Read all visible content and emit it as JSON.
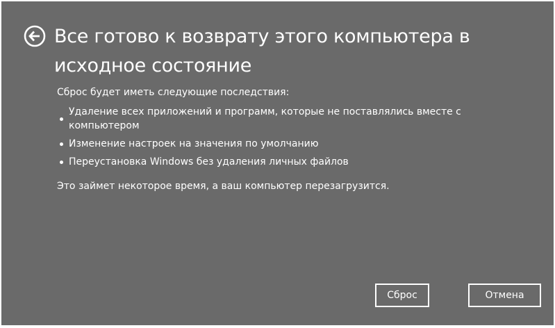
{
  "header": {
    "back_icon": "arrow-left-circle-icon",
    "title": "Все готово к возврату этого компьютера в исходное состояние"
  },
  "body": {
    "intro": "Сброс будет иметь следующие последствия:",
    "bullets": [
      "Удаление всех приложений и программ, которые не поставлялись вместе с компьютером",
      "Изменение настроек на значения по умолчанию",
      "Переустановка Windows без удаления личных файлов"
    ],
    "note": "Это займет некоторое время, а ваш компьютер перезагрузится."
  },
  "buttons": {
    "reset_label": "Сброс",
    "cancel_label": "Отмена"
  },
  "colors": {
    "background": "#6a6a6a",
    "foreground": "#ffffff"
  }
}
